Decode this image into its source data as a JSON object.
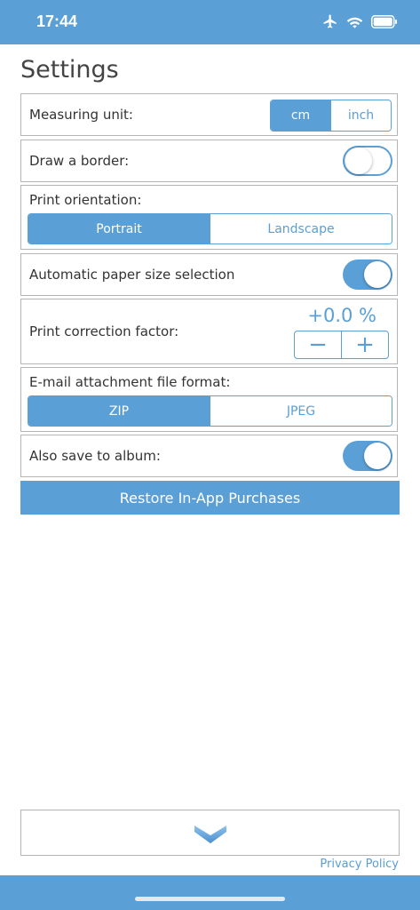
{
  "status_bar": {
    "time": "17:44",
    "icons": [
      "airplane-icon",
      "wifi-icon",
      "battery-icon"
    ]
  },
  "page": {
    "title": "Settings"
  },
  "measuring_unit": {
    "label": "Measuring unit:",
    "options": [
      "cm",
      "inch"
    ],
    "selected": "cm"
  },
  "border": {
    "label": "Draw a border:",
    "enabled": false
  },
  "orientation": {
    "label": "Print orientation:",
    "options": [
      "Portrait",
      "Landscape"
    ],
    "selected": "Portrait"
  },
  "paper_size": {
    "label": "Automatic paper size selection",
    "enabled": true
  },
  "correction": {
    "label": "Print correction factor:",
    "value": "+0.0 %",
    "minus_label": "−",
    "plus_label": "+"
  },
  "attachment_format": {
    "label": "E-mail attachment file format:",
    "options": [
      "ZIP",
      "JPEG"
    ],
    "selected": "ZIP"
  },
  "save_album": {
    "label": "Also save to album:",
    "enabled": true
  },
  "restore": {
    "label": "Restore In-App Purchases"
  },
  "footer": {
    "expand_icon": "chevron-down-icon",
    "privacy_label": "Privacy Policy"
  },
  "colors": {
    "accent": "#5a9fd6",
    "border": "#b5b5b5",
    "text": "#333333"
  }
}
